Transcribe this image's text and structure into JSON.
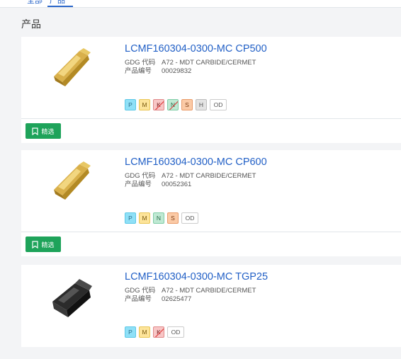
{
  "tabs": [
    {
      "label": "全部"
    },
    {
      "label": "产品"
    }
  ],
  "section_title": "产品",
  "meta_labels": {
    "gdg": "GDG 代码",
    "prod_no": "产品编号"
  },
  "pick_label": "精选",
  "badge_colors": {
    "P": {
      "bg": "#8fe0f7",
      "border": "#5cc8e6",
      "text": "#2b6f8a"
    },
    "M": {
      "bg": "#fde49a",
      "border": "#e9c656",
      "text": "#7a5a10"
    },
    "K": {
      "bg": "#f8c6c6",
      "border": "#e08a8a",
      "text": "#7a2222"
    },
    "N": {
      "bg": "#bfe9d3",
      "border": "#7fcca6",
      "text": "#2a6b4a"
    },
    "S": {
      "bg": "#fbcaa6",
      "border": "#e99b69",
      "text": "#7b3b12"
    },
    "H": {
      "bg": "#e3e3e3",
      "border": "#bdbdbd",
      "text": "#555555"
    }
  },
  "products": [
    {
      "title": "LCMF160304-0300-MC CP500",
      "gdg": "A72 - MDT CARBIDE/CERMET",
      "prod_no": "00029832",
      "image": "gold-insert-icon",
      "badges": [
        {
          "code": "P",
          "crossed": false
        },
        {
          "code": "M",
          "crossed": false
        },
        {
          "code": "K",
          "crossed": true
        },
        {
          "code": "N",
          "crossed": true
        },
        {
          "code": "S",
          "crossed": false
        },
        {
          "code": "H",
          "crossed": false
        },
        {
          "code": "OD",
          "crossed": false
        }
      ]
    },
    {
      "title": "LCMF160304-0300-MC CP600",
      "gdg": "A72 - MDT CARBIDE/CERMET",
      "prod_no": "00052361",
      "image": "gold-insert-icon",
      "badges": [
        {
          "code": "P",
          "crossed": false
        },
        {
          "code": "M",
          "crossed": false
        },
        {
          "code": "N",
          "crossed": false
        },
        {
          "code": "S",
          "crossed": false
        },
        {
          "code": "OD",
          "crossed": false
        }
      ]
    },
    {
      "title": "LCMF160304-0300-MC TGP25",
      "gdg": "A72 - MDT CARBIDE/CERMET",
      "prod_no": "02625477",
      "image": "black-insert-icon",
      "badges": [
        {
          "code": "P",
          "crossed": false
        },
        {
          "code": "M",
          "crossed": false
        },
        {
          "code": "K",
          "crossed": true
        },
        {
          "code": "OD",
          "crossed": false
        }
      ]
    }
  ]
}
